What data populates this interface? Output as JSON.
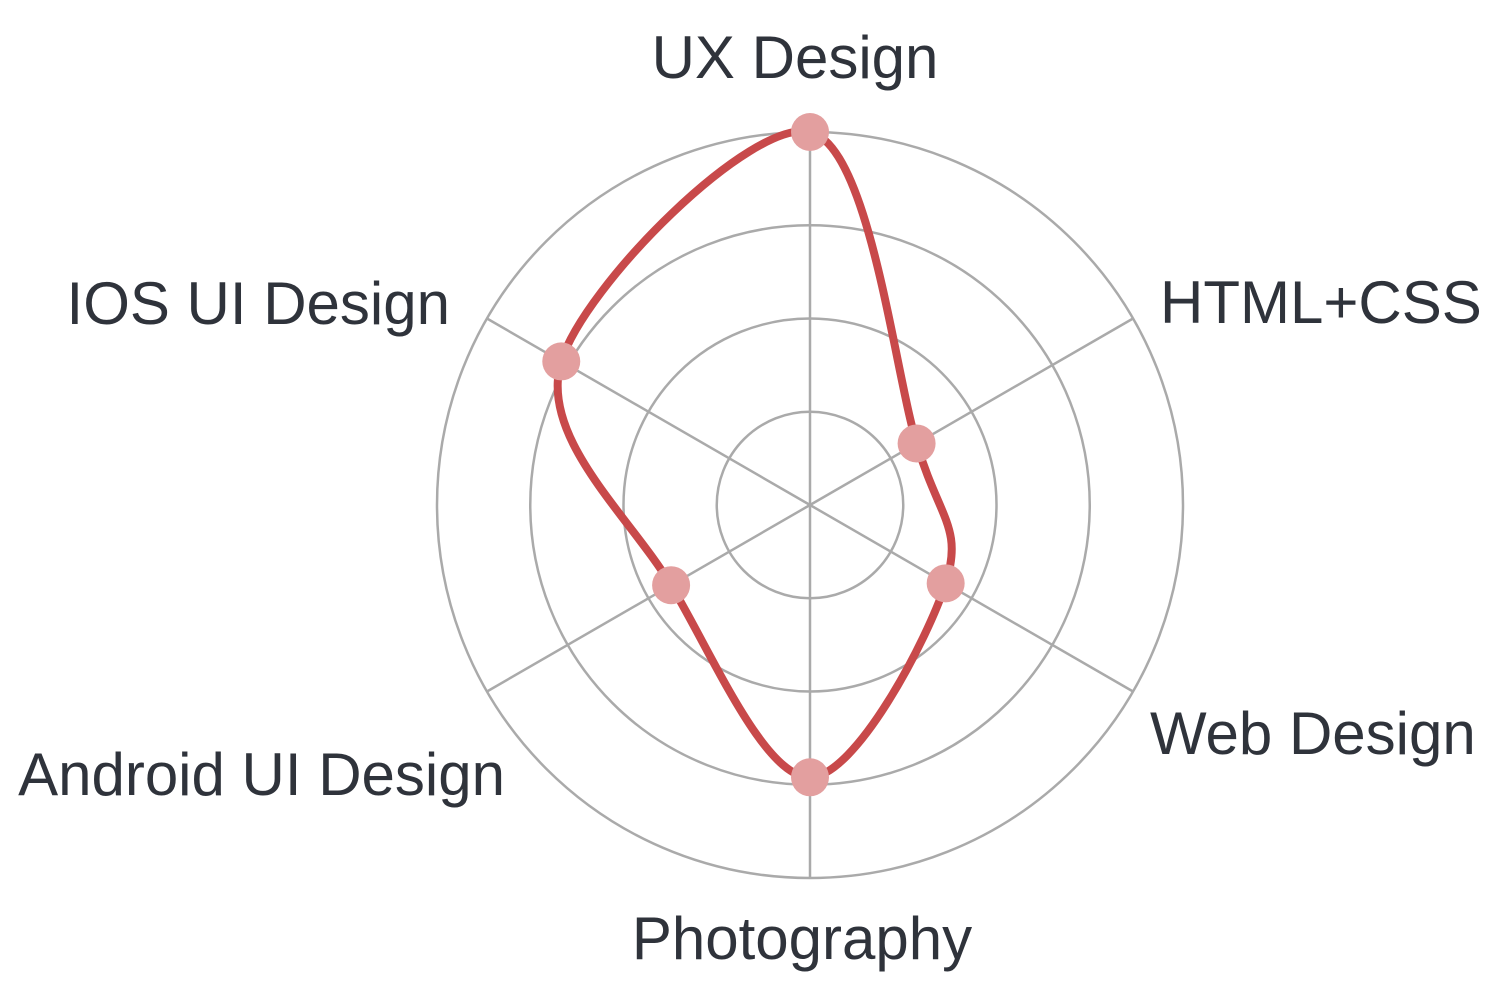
{
  "chart_data": {
    "type": "radar",
    "categories": [
      "UX Design",
      "HTML+CSS",
      "Web Design",
      "Photography",
      "Android UI Design",
      "IOS UI Design"
    ],
    "series": [
      {
        "values": [
          100,
          33,
          42,
          73,
          43,
          77
        ],
        "color": "#c8494a",
        "point_color": "#e39f9f",
        "curve": "smooth"
      }
    ],
    "rlim": [
      0,
      100
    ],
    "grid": true,
    "grid_levels": 4,
    "grid_color": "#aaaaaa",
    "label_color": "#2f333b",
    "legend": "none"
  }
}
